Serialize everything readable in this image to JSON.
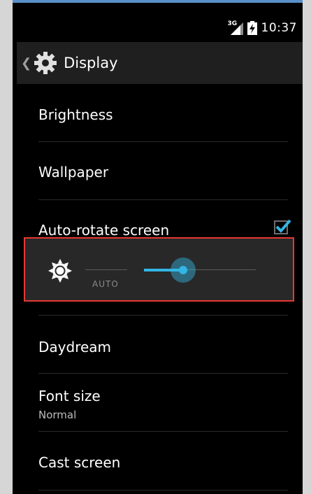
{
  "status_bar": {
    "network_type": "3G",
    "time": "10:37"
  },
  "action_bar": {
    "title": "Display",
    "icon": "gear-icon"
  },
  "settings_items": [
    {
      "title": "Brightness"
    },
    {
      "title": "Wallpaper"
    },
    {
      "title": "Auto-rotate screen",
      "checked": true
    },
    {
      "title": "Daydream"
    },
    {
      "title": "Font size",
      "summary": "Normal"
    },
    {
      "title": "Cast screen"
    }
  ],
  "brightness_dialog": {
    "auto_label": "AUTO",
    "level": 0.35
  },
  "colors": {
    "accent": "#33b5e5",
    "highlight_border": "#e53935",
    "background": "#000000",
    "action_bar": "#1f1f1f"
  }
}
